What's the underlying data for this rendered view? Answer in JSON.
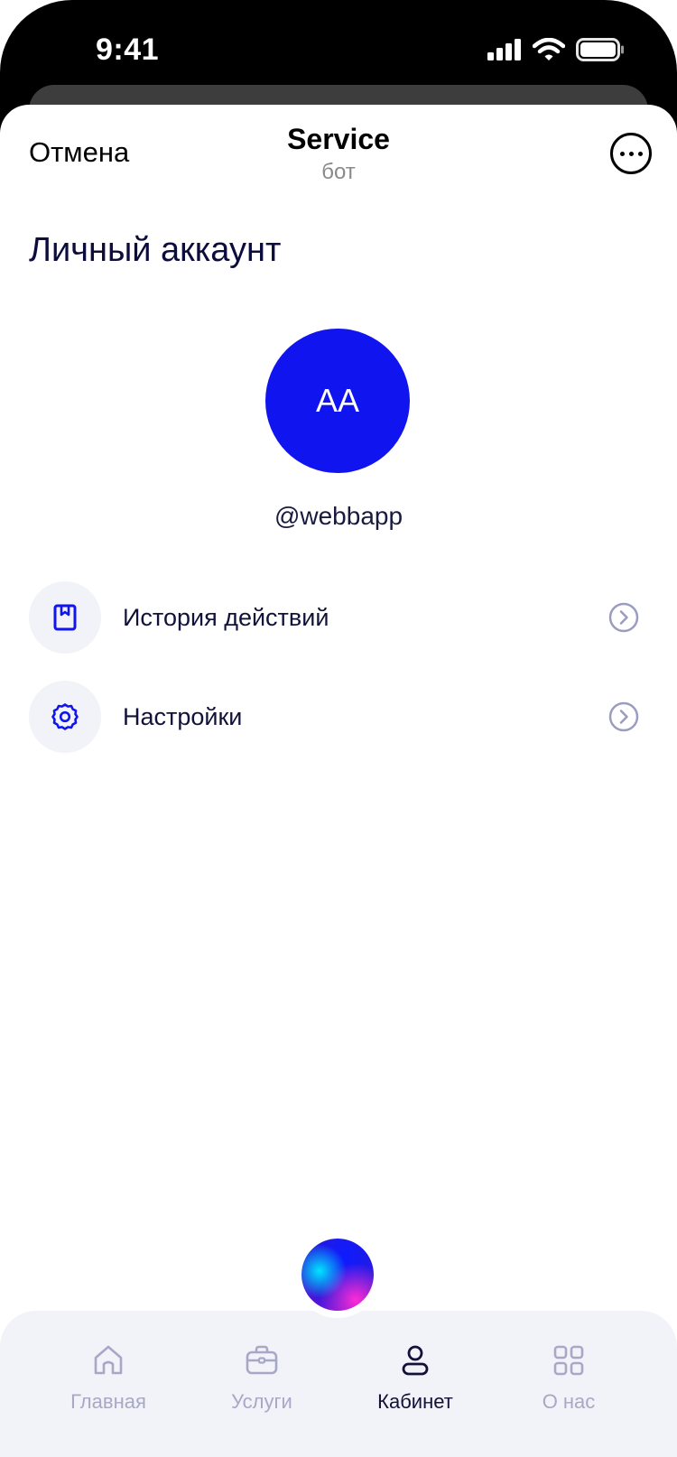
{
  "status_bar": {
    "time": "9:41"
  },
  "header": {
    "cancel_label": "Отмена",
    "title": "Service",
    "subtitle": "бот",
    "more_icon": "ellipsis-circle-icon"
  },
  "page": {
    "title": "Личный аккаунт"
  },
  "profile": {
    "initials": "AA",
    "username": "@webbapp",
    "avatar_color": "#1015f0"
  },
  "menu": {
    "items": [
      {
        "label": "История действий",
        "icon": "bookmark-icon"
      },
      {
        "label": "Настройки",
        "icon": "gear-icon"
      }
    ]
  },
  "tabs": [
    {
      "label": "Главная",
      "icon": "home-icon",
      "active": false
    },
    {
      "label": "Услуги",
      "icon": "briefcase-icon",
      "active": false
    },
    {
      "label": "Кабинет",
      "icon": "user-icon",
      "active": true
    },
    {
      "label": "О нас",
      "icon": "grid-icon",
      "active": false
    }
  ],
  "colors": {
    "accent": "#1015f0",
    "text_primary": "#11113a",
    "tab_inactive": "#a7a8c7",
    "tab_bar_bg": "#f2f3f8"
  }
}
